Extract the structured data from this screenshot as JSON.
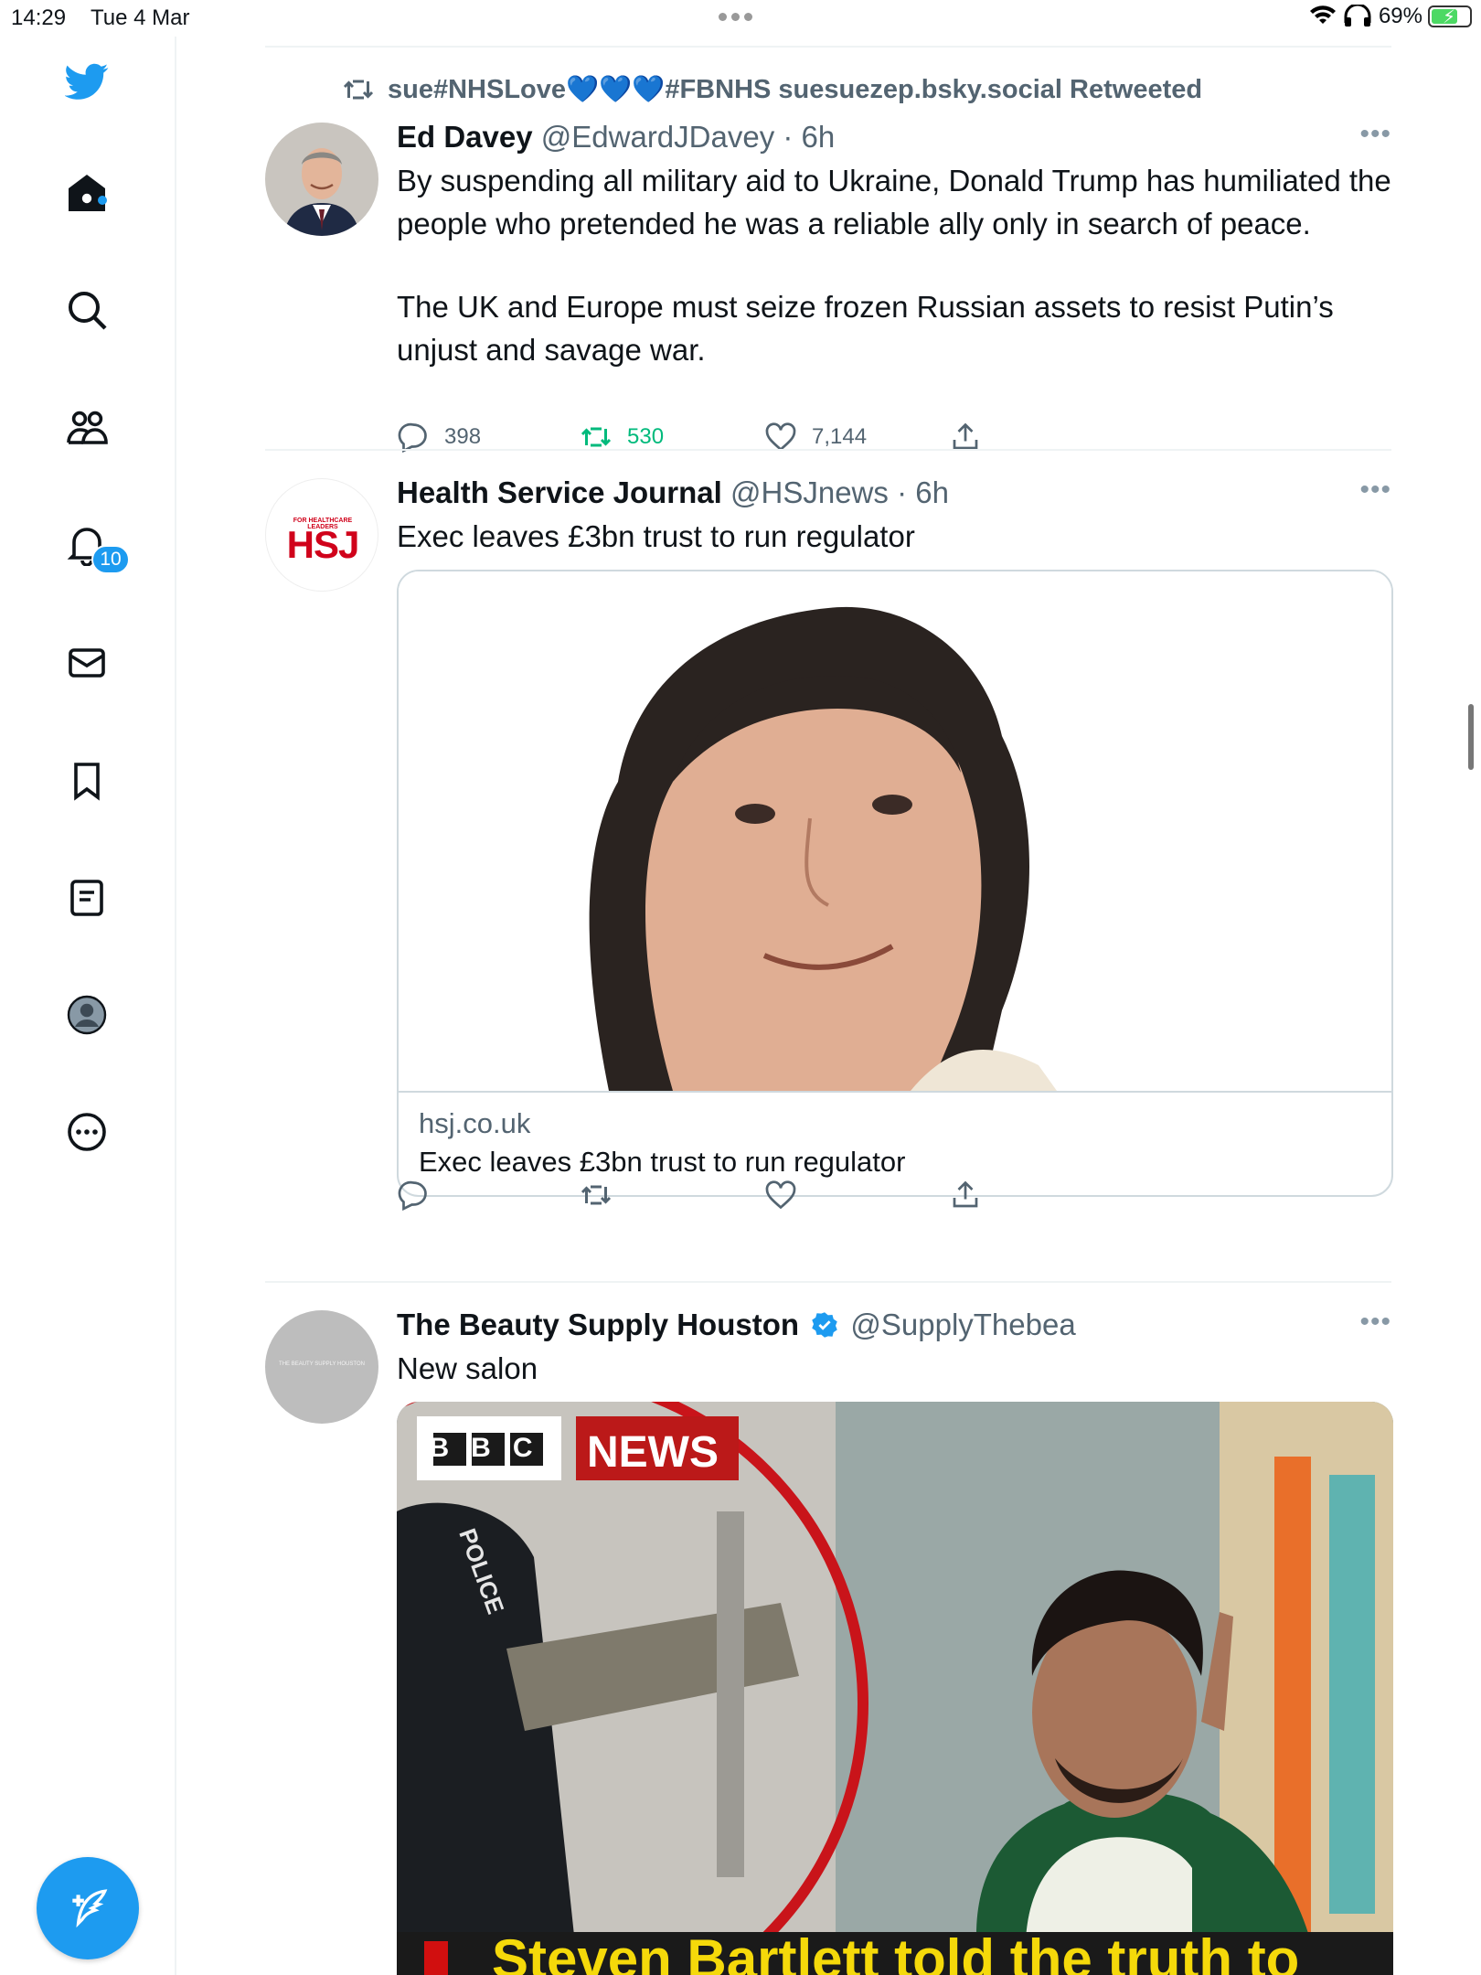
{
  "status_bar": {
    "time": "14:29",
    "date": "Tue 4 Mar",
    "battery": "69%"
  },
  "sidebar": {
    "notification_badge": "10"
  },
  "tweets": [
    {
      "retweeted_by": "sue#NHSLove💙💙💙#FBNHS suesuezep.bsky.social Retweeted",
      "name": "Ed Davey",
      "handle": "@EdwardJDavey",
      "time": "· 6h",
      "text_1": "By suspending all military aid to Ukraine, Donald Trump has humiliated the people who pretended he was a reliable ally only in search of peace.",
      "text_2": "The UK and Europe must seize frozen Russian assets to resist Putin’s unjust and savage war.",
      "replies": "398",
      "retweets": "530",
      "likes": "7,144"
    },
    {
      "name": "Health Service Journal",
      "handle": "@HSJnews",
      "time": "· 6h",
      "avatar_small_text": "FOR HEALTHCARE LEADERS",
      "avatar_logo": "HSJ",
      "text": "Exec leaves £3bn trust to run regulator",
      "card_domain": "hsj.co.uk",
      "card_title": "Exec leaves £3bn trust to run regulator"
    },
    {
      "name": "The Beauty Supply Houston",
      "handle": "@SupplyThebea",
      "avatar_text": "THE BEAUTY SUPPLY HOUSTON",
      "text": "New salon",
      "media_bbc": "BBC",
      "media_news": "NEWS",
      "media_police": "POLICE",
      "media_caption": "Steven Bartlett told the truth to"
    }
  ],
  "colors": {
    "accent": "#1d9bf0",
    "retweet_green": "#00ba7c",
    "hsj_red": "#d0021b",
    "bbc_red": "#bb1919"
  }
}
